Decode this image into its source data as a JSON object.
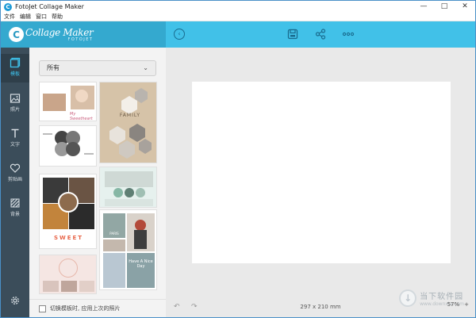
{
  "window": {
    "title": "FotoJet Collage Maker",
    "controls": [
      "—",
      "□",
      "✕"
    ]
  },
  "menu": [
    "文件",
    "编辑",
    "窗口",
    "帮助"
  ],
  "logo": {
    "main": "Collage Maker",
    "sub": "FOTOJET",
    "letter": "C"
  },
  "toolbar": {
    "back_icon": "back-arrow-icon",
    "save_icon": "save-icon",
    "share_icon": "share-icon",
    "more_icon": "more-icon"
  },
  "nav": [
    {
      "label": "模板",
      "icon": "template-icon",
      "active": true
    },
    {
      "label": "照片",
      "icon": "photo-icon",
      "active": false
    },
    {
      "label": "文字",
      "icon": "text-icon",
      "active": false
    },
    {
      "label": "剪贴画",
      "icon": "clipart-icon",
      "active": false
    },
    {
      "label": "背景",
      "icon": "background-icon",
      "active": false
    }
  ],
  "settings_icon": "gear-icon",
  "panel": {
    "dropdown_value": "所有",
    "footer_checkbox_label": "切换模板时, 应用上次的照片",
    "thumbs": [
      {
        "name": "template-baby",
        "text": "My Sweetheart"
      },
      {
        "name": "template-family",
        "text": "FAMILY"
      },
      {
        "name": "template-cloud",
        "text": ""
      },
      {
        "name": "template-dance",
        "text": ""
      },
      {
        "name": "template-sweet",
        "text": "SWEET"
      },
      {
        "name": "template-paris",
        "text": "PARIS"
      },
      {
        "name": "template-niceday",
        "text": "Have A Nice Day"
      },
      {
        "name": "template-pink",
        "text": ""
      }
    ]
  },
  "canvas": {
    "size_label": "297 x 210 mm",
    "zoom": "57%"
  },
  "watermark": {
    "main": "当下软件园",
    "sub": "www.downxia.com"
  }
}
